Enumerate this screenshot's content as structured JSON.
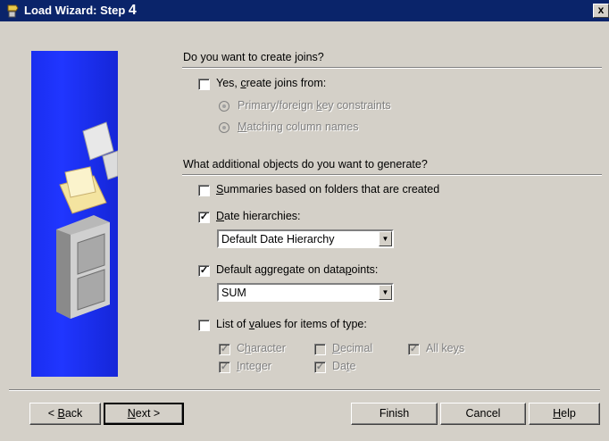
{
  "window": {
    "title_prefix": "Load Wizard: Step ",
    "title_step": "4",
    "close_label": "x"
  },
  "joins": {
    "heading": "Do you want to create joins?",
    "create_label": "Yes, create joins from:",
    "create_checked": false,
    "options": [
      {
        "label": "Primary/foreign key constraints",
        "enabled": false
      },
      {
        "label": "Matching column names",
        "enabled": false
      }
    ]
  },
  "objects": {
    "heading": "What additional objects do you want to generate?",
    "summaries": {
      "label": "Summaries based on folders that are created",
      "checked": false
    },
    "date_hierarchies": {
      "label": "Date hierarchies:",
      "checked": true,
      "selected": "Default Date Hierarchy"
    },
    "default_aggregate": {
      "label": "Default aggregate on datapoints:",
      "checked": true,
      "selected": "SUM"
    },
    "list_of_values": {
      "label": "List of values for items of type:",
      "checked": false
    },
    "types": [
      {
        "label": "Character",
        "checked": true,
        "enabled": false
      },
      {
        "label": "Decimal",
        "checked": false,
        "enabled": false
      },
      {
        "label": "All keys",
        "checked": true,
        "enabled": false
      },
      {
        "label": "Integer",
        "checked": true,
        "enabled": false
      },
      {
        "label": "Date",
        "checked": true,
        "enabled": false
      }
    ]
  },
  "buttons": {
    "back": "< Back",
    "next": "Next >",
    "finish": "Finish",
    "cancel": "Cancel",
    "help": "Help"
  },
  "icons": [
    "wizard-app-icon",
    "close-icon",
    "file-cabinet-illustration",
    "dropdown-arrow-icon"
  ]
}
